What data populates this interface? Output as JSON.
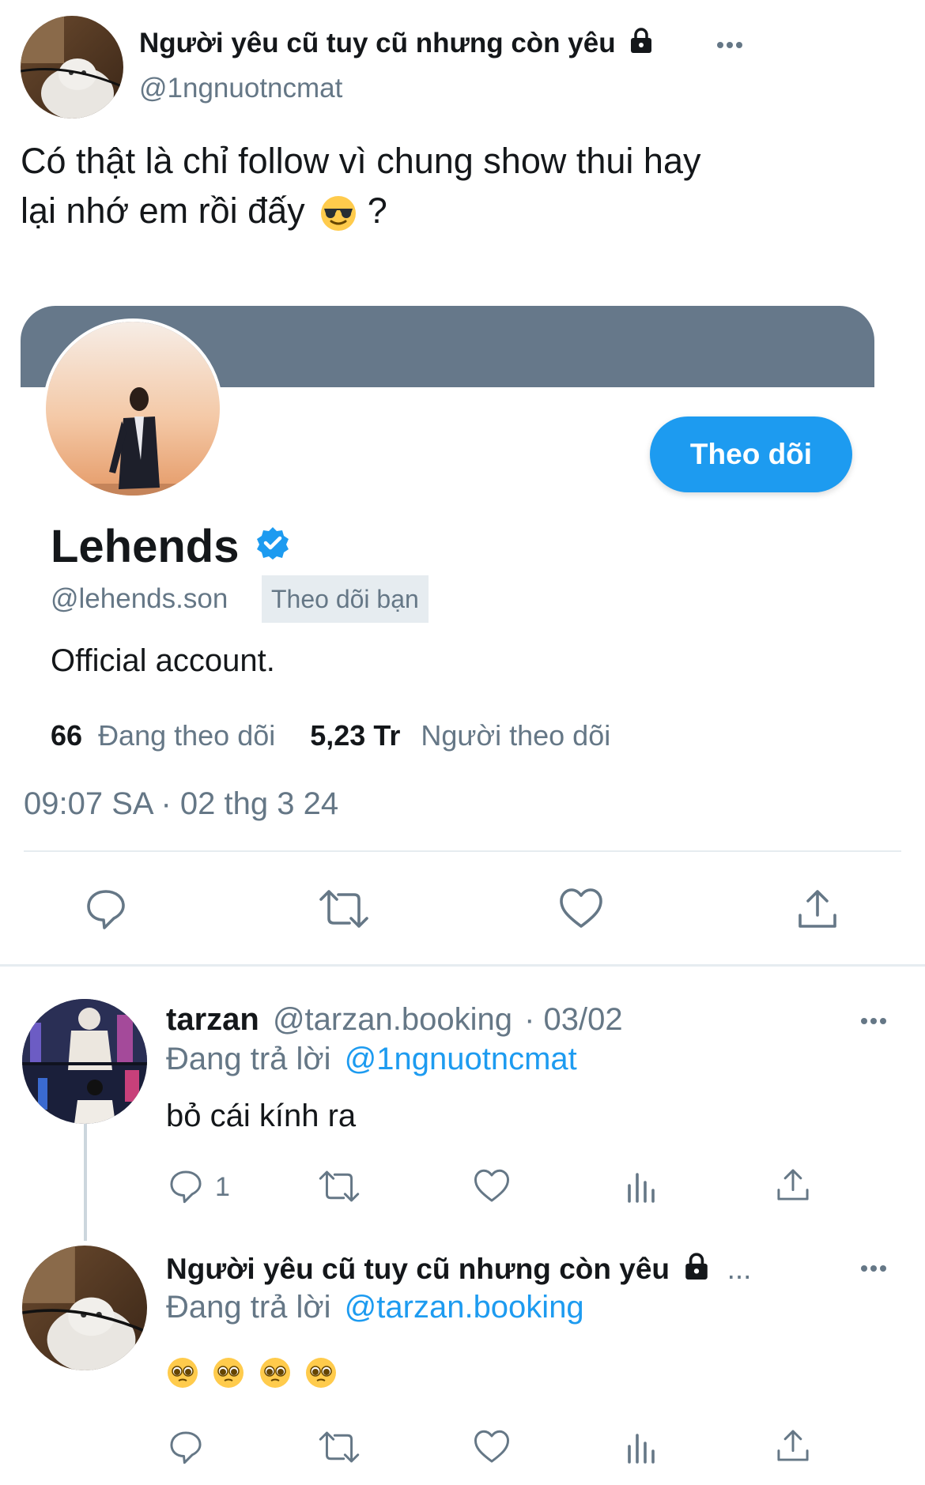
{
  "tweet": {
    "author_name": "Người yêu cũ tuy cũ nhưng còn yêu",
    "author_handle": "@1ngnuotncmat",
    "text_line1": "Có thật là chỉ follow vì chung show thui hay",
    "text_line2": "lại nhớ em rồi đấy",
    "text_tail": "?",
    "timestamp": "09:07 SA · 02 thg 3 24"
  },
  "profile_card": {
    "name": "Lehends",
    "handle": "@lehends.son",
    "follows_you_badge": "Theo dõi bạn",
    "follow_button": "Theo dõi",
    "bio": "Official account.",
    "following_count": "66",
    "following_label": "Đang theo dõi",
    "followers_count": "5,23 Tr",
    "followers_label": "Người theo dõi"
  },
  "replies": [
    {
      "name": "tarzan",
      "handle": "@tarzan.booking",
      "date": "· 03/02",
      "replying_label": "Đang trả lời",
      "replying_to": "@1ngnuotncmat",
      "text": "bỏ cái kính ra",
      "reply_count": "1"
    },
    {
      "name": "Người yêu cũ tuy cũ nhưng còn yêu",
      "ellipsis": "...",
      "replying_label": "Đang trả lời",
      "replying_to": "@tarzan.booking"
    }
  ],
  "icons": [
    "lock-icon",
    "more-icon",
    "reply-icon",
    "retweet-icon",
    "like-icon",
    "share-icon",
    "views-icon",
    "verified-icon"
  ],
  "colors": {
    "accent": "#1d9bf0",
    "muted": "#657786",
    "banner": "#66788a",
    "badge_bg": "#e6ecf0"
  }
}
